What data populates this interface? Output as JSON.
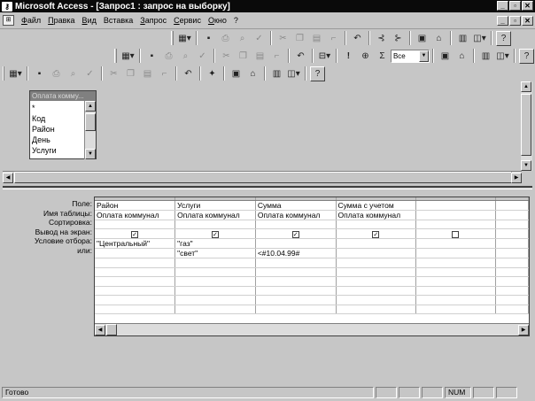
{
  "window": {
    "title": "Microsoft Access - [Запрос1 : запрос на выборку]",
    "minimize": "_",
    "restore": "▫",
    "close": "✕"
  },
  "menu": {
    "items": [
      {
        "u": "Ф",
        "rest": "айл"
      },
      {
        "u": "П",
        "rest": "равка"
      },
      {
        "u": "В",
        "rest": "ид"
      },
      {
        "u": "",
        "rest": "Вставка"
      },
      {
        "u": "З",
        "rest": "апрос"
      },
      {
        "u": "С",
        "rest": "ервис"
      },
      {
        "u": "О",
        "rest": "кно"
      },
      {
        "u": "",
        "rest": "?"
      }
    ]
  },
  "toolbar2": {
    "top_values": "Все"
  },
  "field_list": {
    "title": "Оплата комму...",
    "items": [
      "*",
      "Код",
      "Район",
      "День",
      "Услуги"
    ]
  },
  "grid": {
    "row_labels": [
      "Поле:",
      "Имя таблицы:",
      "Сортировка:",
      "Вывод на экран:",
      "Условие отбора:",
      "или:"
    ],
    "columns": [
      {
        "field": "Район",
        "table": "Оплата коммунал",
        "criteria": "\"Центральный\"",
        "or": ""
      },
      {
        "field": "Услуги",
        "table": "Оплата коммунал",
        "criteria": "\"газ\"",
        "or": "\"свет\""
      },
      {
        "field": "Сумма",
        "table": "Оплата коммунал",
        "criteria": "",
        "or": "<#10.04.99#"
      },
      {
        "field": "Сумма с учетом",
        "table": "Оплата коммунал",
        "criteria": "",
        "or": ""
      }
    ],
    "show_checks": [
      "✓",
      "✓",
      "✓",
      "✓",
      ""
    ]
  },
  "status": {
    "ready": "Готово",
    "num": "NUM"
  }
}
